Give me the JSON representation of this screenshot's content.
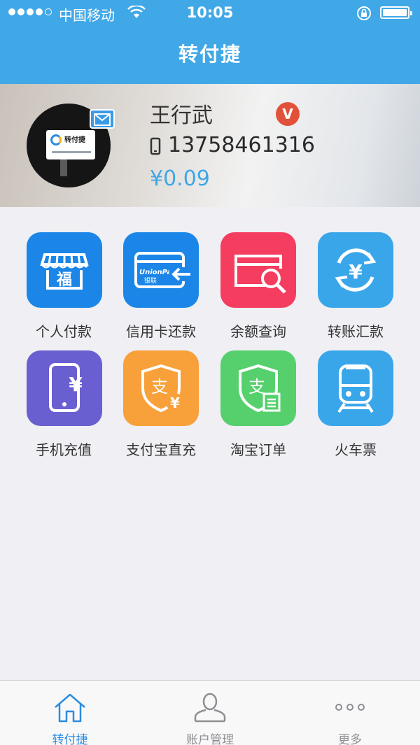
{
  "status_bar": {
    "carrier": "中国移动",
    "time": "10:05"
  },
  "header": {
    "title": "转付捷"
  },
  "profile": {
    "name": "王行武",
    "vip_badge": "V",
    "phone": "13758461316",
    "balance": "¥0.09",
    "avatar_text": "转付捷"
  },
  "services": [
    {
      "label": "个人付款",
      "color": "#1b86e8",
      "icon": "shop-icon",
      "glyph": "福"
    },
    {
      "label": "信用卡还款",
      "color": "#1b86e8",
      "icon": "credit-card-icon",
      "card_text": "UnionPay",
      "card_sub": "银联"
    },
    {
      "label": "余额查询",
      "color": "#f43d5f",
      "icon": "card-search-icon"
    },
    {
      "label": "转账汇款",
      "color": "#3aa6ea",
      "icon": "transfer-icon",
      "glyph": "¥"
    },
    {
      "label": "手机充值",
      "color": "#6a5fd0",
      "icon": "phone-recharge-icon",
      "glyph": "¥"
    },
    {
      "label": "支付宝直充",
      "color": "#f8a03a",
      "icon": "alipay-shield-icon",
      "glyph": "支",
      "glyph2": "¥"
    },
    {
      "label": "淘宝订单",
      "color": "#55d06c",
      "icon": "taobao-order-icon",
      "glyph": "支"
    },
    {
      "label": "火车票",
      "color": "#3aa6ea",
      "icon": "train-icon"
    }
  ],
  "tabbar": {
    "items": [
      {
        "label": "转付捷",
        "icon": "home-icon",
        "active": true
      },
      {
        "label": "账户管理",
        "icon": "user-icon",
        "active": false
      },
      {
        "label": "更多",
        "icon": "more-icon",
        "active": false
      }
    ],
    "active_color": "#2b8ce0",
    "inactive_color": "#8e8e93"
  }
}
